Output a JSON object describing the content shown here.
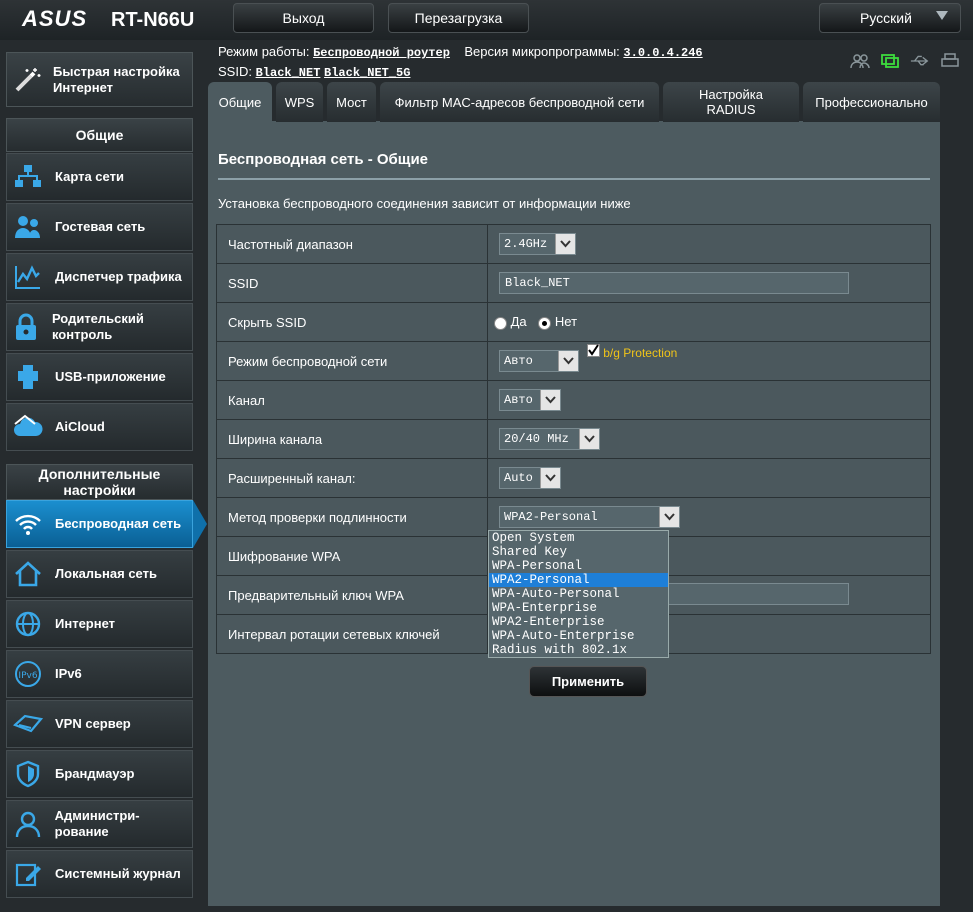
{
  "header": {
    "brand": "ASUS",
    "model": "RT-N66U",
    "logout_label": "Выход",
    "reboot_label": "Перезагрузка",
    "language_label": "Русский"
  },
  "info": {
    "mode_label": "Режим работы:",
    "mode_value": "Беспроводной роутер",
    "firmware_label": "Версия микропрограммы:",
    "firmware_value": "3.0.0.4.246",
    "ssid_label": "SSID:",
    "ssid_values": [
      "Black_NET",
      "Black_NET_5G"
    ]
  },
  "sidebar": {
    "quick_setup": "Быстрая настройка Интернет",
    "general_header": "Общие",
    "general_items": [
      {
        "label": "Карта сети",
        "icon": "network-map-icon"
      },
      {
        "label": "Гостевая сеть",
        "icon": "guest-network-icon"
      },
      {
        "label": "Диспетчер трафика",
        "icon": "traffic-manager-icon"
      },
      {
        "label": "Родительский контроль",
        "icon": "parental-control-icon"
      },
      {
        "label": "USB-приложение",
        "icon": "usb-app-icon"
      },
      {
        "label": "AiCloud",
        "icon": "aicloud-icon"
      }
    ],
    "advanced_header": "Дополнительные настройки",
    "advanced_items": [
      {
        "label": "Беспроводная сеть",
        "icon": "wireless-icon"
      },
      {
        "label": "Локальная сеть",
        "icon": "lan-icon"
      },
      {
        "label": "Интернет",
        "icon": "internet-icon"
      },
      {
        "label": "IPv6",
        "icon": "ipv6-icon"
      },
      {
        "label": "VPN сервер",
        "icon": "vpn-icon"
      },
      {
        "label": "Брандмауэр",
        "icon": "firewall-icon"
      },
      {
        "label": "Администри-рование",
        "icon": "administration-icon"
      },
      {
        "label": "Системный журнал",
        "icon": "system-log-icon"
      }
    ]
  },
  "tabs": [
    "Общие",
    "WPS",
    "Мост",
    "Фильтр MAC-адресов беспроводной сети",
    "Настройка RADIUS",
    "Профессионально"
  ],
  "panel": {
    "title": "Беспроводная сеть - Общие",
    "description": "Установка беспроводного соединения зависит от информации ниже",
    "rows": {
      "band": {
        "label": "Частотный диапазон",
        "value": "2.4GHz"
      },
      "ssid": {
        "label": "SSID",
        "value": "Black_NET"
      },
      "hide_ssid": {
        "label": "Скрыть SSID",
        "yes": "Да",
        "no": "Нет"
      },
      "wireless_mode": {
        "label": "Режим беспроводной сети",
        "value": "Авто",
        "protection": "b/g Protection"
      },
      "channel": {
        "label": "Канал",
        "value": "Авто"
      },
      "bandwidth": {
        "label": "Ширина канала",
        "value": "20/40 MHz"
      },
      "ext_channel": {
        "label": "Расширенный канал:",
        "value": "Auto"
      },
      "auth_method": {
        "label": "Метод проверки подлинности",
        "value": "WPA2-Personal"
      },
      "wpa_encryption": {
        "label": "Шифрование WPA"
      },
      "wpa_key": {
        "label": "Предварительный ключ WPA"
      },
      "key_rotation": {
        "label": "Интервал ротации сетевых ключей"
      }
    },
    "auth_options": [
      "Open System",
      "Shared Key",
      "WPA-Personal",
      "WPA2-Personal",
      "WPA-Auto-Personal",
      "WPA-Enterprise",
      "WPA2-Enterprise",
      "WPA-Auto-Enterprise",
      "Radius with 802.1x"
    ],
    "apply_label": "Применить"
  },
  "colors": {
    "accent": "#1b8fcf",
    "panel": "#4d5b60",
    "protection_text": "#f0c419",
    "dropdown_highlight": "#1e7fd8"
  }
}
